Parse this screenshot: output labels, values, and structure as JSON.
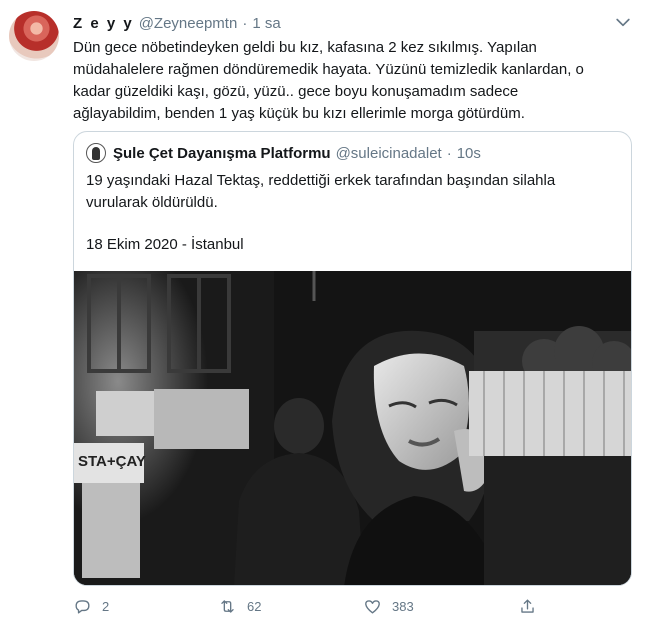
{
  "tweet": {
    "author_name": "Z e y y",
    "author_handle": "@Zeyneepmtn",
    "separator": "·",
    "time": "1 sa",
    "body_lines": [
      "Dün gece nöbetindeyken geldi bu kız, kafasına 2 kez sıkılmış. Yapılan",
      "müdahalelere rağmen döndüremedik hayata. Yüzünü temizledik kanlardan, o",
      "kadar güzeldiki kaşı, gözü, yüzü..  gece boyu konuşamadım sadece",
      "ağlayabildim, benden 1 yaş küçük bu kızı ellerimle morga götürdüm."
    ]
  },
  "quoted": {
    "author_name": "Şule Çet Dayanışma Platformu",
    "author_handle": "@suleicinadalet",
    "separator": "·",
    "time": "10s",
    "text_lines": [
      "19 yaşındaki Hazal Tektaş, reddettiği erkek tarafından başından silahla",
      "vurularak öldürüldü."
    ],
    "date_line": "18 Ekim 2020 - İstanbul"
  },
  "actions": {
    "reply_count": "2",
    "retweet_count": "62",
    "like_count": "383"
  },
  "icons": [
    "chevron-down-icon",
    "reply-icon",
    "retweet-icon",
    "heart-icon",
    "share-icon"
  ],
  "colors": {
    "text": "#14171a",
    "secondary": "#657786",
    "border": "#ccd6dd"
  }
}
